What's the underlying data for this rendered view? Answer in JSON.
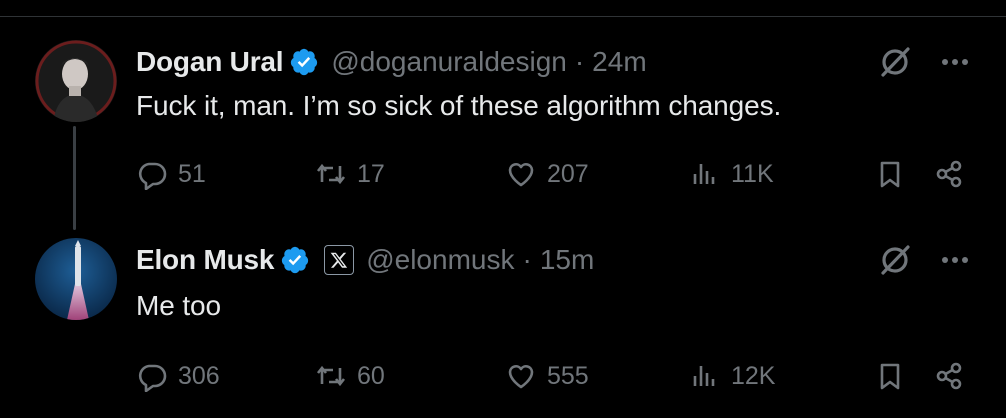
{
  "tweets": [
    {
      "name": "Dogan Ural",
      "handle": "@doganuraldesign",
      "separator": "·",
      "time": "24m",
      "text": "Fuck it, man. I’m so sick of these algorithm changes.",
      "verified": true,
      "affiliation_badge": false,
      "stats": {
        "replies": "51",
        "reposts": "17",
        "likes": "207",
        "views": "11K"
      }
    },
    {
      "name": "Elon Musk",
      "handle": "@elonmusk",
      "separator": "·",
      "time": "15m",
      "text": "Me too",
      "verified": true,
      "affiliation_badge": "x-logo",
      "stats": {
        "replies": "306",
        "reposts": "60",
        "likes": "555",
        "views": "12K"
      }
    }
  ],
  "colors": {
    "background": "#000000",
    "text": "#e7e9ea",
    "muted": "#71767b",
    "verified": "#1d9bf0"
  },
  "icons": [
    "reply-icon",
    "repost-icon",
    "like-icon",
    "views-icon",
    "bookmark-icon",
    "share-icon",
    "grok-icon",
    "more-icon",
    "verified-badge-icon",
    "x-logo-icon"
  ]
}
